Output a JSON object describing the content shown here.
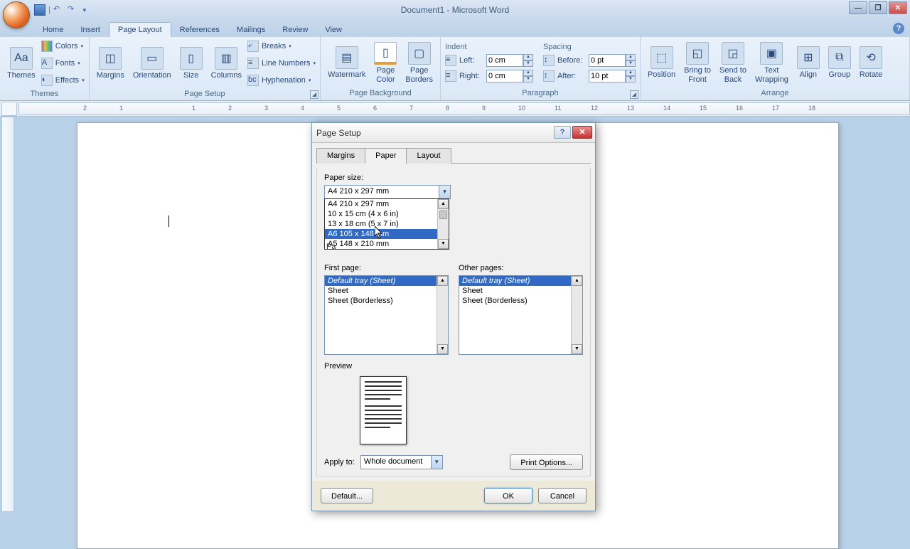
{
  "window": {
    "title": "Document1 - Microsoft Word",
    "minimize": "—",
    "maximize": "❐",
    "close": "✕",
    "help": "?"
  },
  "tabs": {
    "home": "Home",
    "insert": "Insert",
    "page_layout": "Page Layout",
    "references": "References",
    "mailings": "Mailings",
    "review": "Review",
    "view": "View"
  },
  "ribbon": {
    "themes": {
      "btn": "Themes",
      "colors": "Colors",
      "fonts": "Fonts",
      "effects": "Effects",
      "group": "Themes"
    },
    "page_setup": {
      "margins": "Margins",
      "orientation": "Orientation",
      "size": "Size",
      "columns": "Columns",
      "breaks": "Breaks",
      "line_numbers": "Line Numbers",
      "hyphenation": "Hyphenation",
      "group": "Page Setup"
    },
    "page_bg": {
      "watermark": "Watermark",
      "page_color": "Page\nColor",
      "page_borders": "Page\nBorders",
      "group": "Page Background"
    },
    "paragraph": {
      "indent": "Indent",
      "left": "Left:",
      "right": "Right:",
      "left_val": "0 cm",
      "right_val": "0 cm",
      "spacing": "Spacing",
      "before": "Before:",
      "after": "After:",
      "before_val": "0 pt",
      "after_val": "10 pt",
      "group": "Paragraph"
    },
    "arrange": {
      "position": "Position",
      "bring_front": "Bring to\nFront",
      "send_back": "Send to\nBack",
      "text_wrap": "Text\nWrapping",
      "align": "Align",
      "group_btn": "Group",
      "rotate": "Rotate",
      "group": "Arrange"
    }
  },
  "ruler_marks": [
    "2",
    "1",
    "",
    "1",
    "2",
    "3",
    "4",
    "5",
    "6",
    "7",
    "8",
    "9",
    "10",
    "11",
    "12",
    "13",
    "14",
    "15",
    "16",
    "17",
    "18"
  ],
  "dialog": {
    "title": "Page Setup",
    "tabs": {
      "margins": "Margins",
      "paper": "Paper",
      "layout": "Layout"
    },
    "paper_size_label": "Paper size:",
    "paper_size_value": "A4 210 x 297 mm",
    "dropdown": {
      "opt0": "A4 210 x 297 mm",
      "opt1": "10 x 15 cm (4 x 6 in)",
      "opt2": "13 x 18 cm (5 x 7 in)",
      "opt3": "A6 105 x 148 mm",
      "opt4": "A5 148 x 210 mm"
    },
    "paper_source_hidden": "Pa",
    "first_page": "First page:",
    "other_pages": "Other pages:",
    "tray_default": "Default tray (Sheet)",
    "tray_sheet": "Sheet",
    "tray_borderless": "Sheet (Borderless)",
    "preview": "Preview",
    "apply_to": "Apply to:",
    "apply_value": "Whole document",
    "print_options": "Print Options...",
    "default_btn": "Default...",
    "ok": "OK",
    "cancel": "Cancel"
  }
}
